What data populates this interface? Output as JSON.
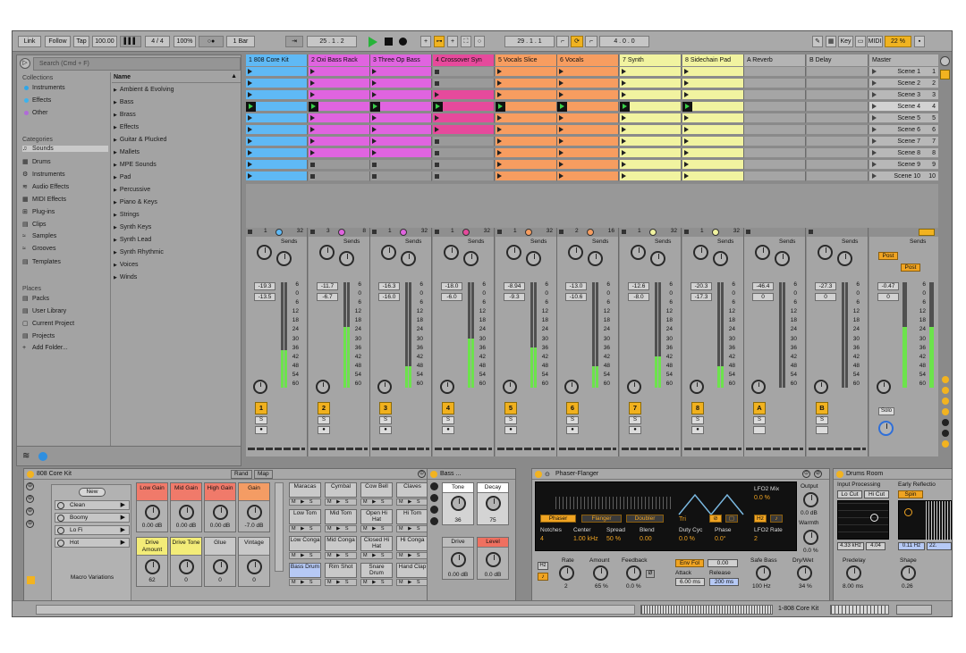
{
  "transport": {
    "link": "Link",
    "follow": "Follow",
    "tap": "Tap",
    "tempo": "100.00",
    "nudge": "▌▌▌",
    "signature": "4 / 4",
    "zoom": "100%",
    "metro": "○●",
    "quantize": "1 Bar",
    "position": "25 .   1 .   2",
    "loop_start": "29 .   1 .   1",
    "loop_length": "4 .   0 .   0",
    "key": "Key",
    "midi": "MIDI",
    "cpu": "22 %"
  },
  "browser": {
    "search_placeholder": "Search (Cmd + F)",
    "collections_title": "Collections",
    "collections": [
      {
        "label": "Instruments",
        "color": "#2fa6e8"
      },
      {
        "label": "Effects",
        "color": "#3bb3ee"
      },
      {
        "label": "Other",
        "color": "#b06ad9"
      }
    ],
    "categories_title": "Categories",
    "categories": [
      "Sounds",
      "Drums",
      "Instruments",
      "Audio Effects",
      "MIDI Effects",
      "Plug-ins",
      "Clips",
      "Samples",
      "Grooves",
      "Templates"
    ],
    "places_title": "Places",
    "places": [
      "Packs",
      "User Library",
      "Current Project",
      "Projects",
      "Add Folder..."
    ],
    "name_header": "Name",
    "names": [
      "Ambient & Evolving",
      "Bass",
      "Brass",
      "Effects",
      "Guitar & Plucked",
      "Mallets",
      "MPE Sounds",
      "Pad",
      "Percussive",
      "Piano & Keys",
      "Strings",
      "Synth Keys",
      "Synth Lead",
      "Synth Rhythmic",
      "Voices",
      "Winds"
    ]
  },
  "tracks": [
    {
      "name": "1 808 Core Kit",
      "color": "#5fb9f5",
      "num": "1",
      "vol": "-19.3",
      "pan": "-13.5",
      "a": "1",
      "b": "32"
    },
    {
      "name": "2 Oxi Bass Rack",
      "color": "#e064e0",
      "num": "2",
      "vol": "-11.7",
      "pan": "-6.7",
      "a": "3",
      "b": "8"
    },
    {
      "name": "3 Three Op Bass",
      "color": "#e064e0",
      "num": "3",
      "vol": "-16.3",
      "pan": "-16.0",
      "a": "1",
      "b": "32"
    },
    {
      "name": "4 Crossover Syn",
      "color": "#e64a9c",
      "num": "4",
      "vol": "-18.0",
      "pan": "-6.0",
      "a": "1",
      "b": "32"
    },
    {
      "name": "5 Vocals Slice",
      "color": "#f79d60",
      "num": "5",
      "vol": "-8.94",
      "pan": "-9.3",
      "a": "1",
      "b": "32"
    },
    {
      "name": "6 Vocals",
      "color": "#f79d60",
      "num": "6",
      "vol": "-13.0",
      "pan": "-10.6",
      "a": "2",
      "b": "16"
    },
    {
      "name": "7 Synth",
      "color": "#f1f3a0",
      "num": "7",
      "vol": "-12.6",
      "pan": "-8.0",
      "a": "1",
      "b": "32"
    },
    {
      "name": "8 Sidechain Pad",
      "color": "#f1f3a0",
      "num": "8",
      "vol": "-20.3",
      "pan": "-17.3",
      "a": "1",
      "b": "32"
    }
  ],
  "returns": [
    {
      "name": "A Reverb",
      "num": "A",
      "vol": "-46.4",
      "pan": "0"
    },
    {
      "name": "B Delay",
      "num": "B",
      "vol": "-27.3",
      "pan": "0"
    }
  ],
  "master": {
    "name": "Master",
    "vol": "-0.47",
    "pan": "0",
    "solo": "Solo",
    "post1": "Post",
    "post2": "Post"
  },
  "scenes": [
    "Scene 1",
    "Scene 2",
    "Scene 3",
    "Scene 4",
    "Scene 5",
    "Scene 6",
    "Scene 7",
    "Scene 8",
    "Scene 9",
    "Scene 10"
  ],
  "scene_nums": [
    "1",
    "2",
    "3",
    "4",
    "5",
    "6",
    "7",
    "8",
    "9",
    "10"
  ],
  "sends_label": "Sends",
  "scale": [
    "6",
    "0",
    "6",
    "12",
    "18",
    "24",
    "30",
    "36",
    "42",
    "48",
    "54",
    "60"
  ],
  "rack": {
    "title": "808 Core Kit",
    "rand": "Rand",
    "map": "Map",
    "new": "New",
    "variations": [
      "Clean",
      "Boomy",
      "Lo Fi",
      "Hot"
    ],
    "variations_label": "Macro Variations",
    "macros": [
      {
        "label": "Low Gain",
        "value": "0.00 dB",
        "color": "#f07a6a"
      },
      {
        "label": "Mid Gain",
        "value": "0.00 dB",
        "color": "#f07a6a"
      },
      {
        "label": "High Gain",
        "value": "0.00 dB",
        "color": "#f07a6a"
      },
      {
        "label": "Gain",
        "value": "-7.0 dB",
        "color": "#f49c64"
      },
      {
        "label": "Drive Amount",
        "value": "62",
        "color": "#f3ec78"
      },
      {
        "label": "Drive Tone",
        "value": "0",
        "color": "#f3ec78"
      },
      {
        "label": "Glue",
        "value": "0",
        "color": "#c8c8c8"
      },
      {
        "label": "Vintage",
        "value": "0",
        "color": "#c8c8c8"
      }
    ],
    "pads": [
      "Maracas",
      "Cymbal",
      "Cow Bell",
      "Claves",
      "Low Tom",
      "Mid Tom",
      "Open Hi Hat",
      "Hi Tom",
      "Low Conga",
      "Mid Conga",
      "Closed Hi Hat",
      "Hi Conga",
      "Bass Drum",
      "Rim Shot",
      "Snare Drum",
      "Hand Clap"
    ],
    "pad_buttons": "M ▶ S"
  },
  "bass": {
    "title": "Bass ...",
    "tone": "Tone",
    "tone_val": "36",
    "decay": "Decay",
    "decay_val": "75",
    "drive": "Drive",
    "drive_val": "0.00 dB",
    "level": "Level",
    "level_val": "0.0 dB"
  },
  "phaser": {
    "title": "Phaser-Flanger",
    "lfo2_mix": "LFO2 Mix",
    "lfo2_mix_val": "0.0 %",
    "modes": [
      "Phaser",
      "Flanger",
      "Doubler"
    ],
    "params": [
      {
        "label": "Notches",
        "value": "4"
      },
      {
        "label": "Center",
        "value": "1.00 kHz"
      },
      {
        "label": "Spread",
        "value": "50 %"
      },
      {
        "label": "Blend",
        "value": "0.00"
      }
    ],
    "wave": "Tri",
    "duty": "Duty Cyc",
    "duty_val": "0.0 %",
    "phase": "Phase",
    "phase_val": "0.0°",
    "hz": "Hz",
    "lfo2_rate": "LFO2 Rate",
    "lfo2_rate_val": "2",
    "output": "Output",
    "output_val": "0.0 dB",
    "warmth": "Warmth",
    "warmth_val": "0.0 %",
    "rate": "Rate",
    "rate_val": "2",
    "amount": "Amount",
    "amount_val": "65 %",
    "feedback": "Feedback",
    "feedback_val": "0.0 %",
    "invert": "Ø",
    "env_fol": "Env Fol",
    "env_val": "0.00",
    "attack": "Attack",
    "attack_val": "6.00 ms",
    "release": "Release",
    "release_val": "200 ms",
    "safe_bass": "Safe Bass",
    "safe_bass_val": "100 Hz",
    "drywet": "Dry/Wet",
    "drywet_val": "34 %"
  },
  "drums_room": {
    "title": "Drums Room",
    "input_processing": "Input Processing",
    "early": "Early Reflectio",
    "locut": "Lo Cut",
    "hicut": "Hi Cut",
    "spin": "Spin",
    "freq1": "4.33 kHz",
    "freq2": "4.04",
    "freq3": "0.11 Hz",
    "freq4": "22.",
    "predelay": "Predelay",
    "predelay_val": "8.00 ms",
    "shape": "Shape",
    "shape_val": "0.26"
  },
  "status": {
    "track": "1-808 Core Kit"
  }
}
